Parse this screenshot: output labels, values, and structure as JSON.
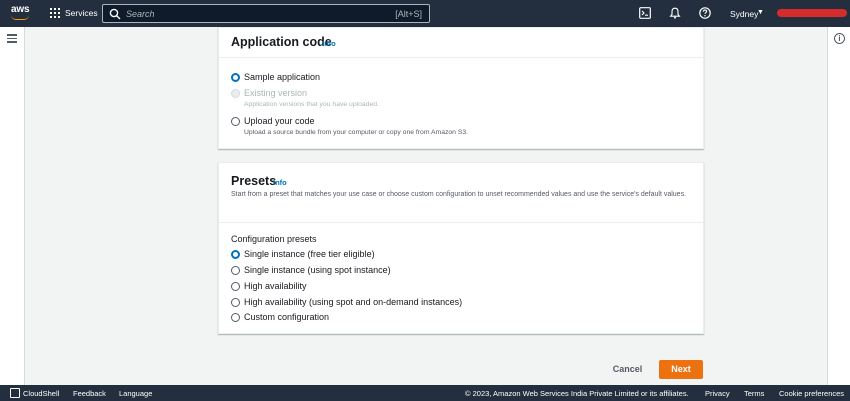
{
  "topnav": {
    "logo_text": "aws",
    "services_label": "Services",
    "search_placeholder": "Search",
    "search_shortcut": "[Alt+S]",
    "region": "Sydney"
  },
  "app_code": {
    "title": "Application code",
    "info": "Info",
    "options": [
      {
        "label": "Sample application",
        "description": "",
        "state": "checked"
      },
      {
        "label": "Existing version",
        "description": "Application versions that you have uploaded.",
        "state": "disabled"
      },
      {
        "label": "Upload your code",
        "description": "Upload a source bundle from your computer or copy one from Amazon S3.",
        "state": "unchecked"
      }
    ]
  },
  "presets": {
    "title": "Presets",
    "info": "Info",
    "description": "Start from a preset that matches your use case or choose custom configuration to unset recommended values and use the service's default values.",
    "group_label": "Configuration presets",
    "options": [
      {
        "label": "Single instance (free tier eligible)",
        "state": "checked"
      },
      {
        "label": "Single instance (using spot instance)",
        "state": "unchecked"
      },
      {
        "label": "High availability",
        "state": "unchecked"
      },
      {
        "label": "High availability (using spot and on-demand instances)",
        "state": "unchecked"
      },
      {
        "label": "Custom configuration",
        "state": "unchecked"
      }
    ]
  },
  "actions": {
    "cancel": "Cancel",
    "next": "Next"
  },
  "footer": {
    "cloudshell": "CloudShell",
    "feedback": "Feedback",
    "language": "Language",
    "copyright": "© 2023, Amazon Web Services India Private Limited or its affiliates.",
    "privacy": "Privacy",
    "terms": "Terms",
    "cookie": "Cookie preferences"
  },
  "colors": {
    "nav_bg": "#232f3e",
    "accent": "#0073bb",
    "primary_button": "#ec7211",
    "logo_smile": "#ff9900"
  }
}
